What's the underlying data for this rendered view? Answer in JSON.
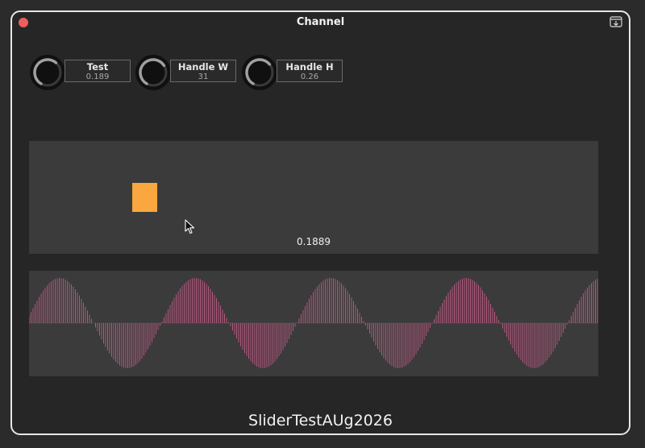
{
  "window": {
    "title": "Channel"
  },
  "knobs": [
    {
      "name": "Test",
      "value": "0.189",
      "level": 0.189
    },
    {
      "name": "Handle W",
      "value": "31",
      "level": 0.31
    },
    {
      "name": "Handle H",
      "value": "0.26",
      "level": 0.26
    }
  ],
  "slider": {
    "value": "0.1889",
    "level": 0.1889
  },
  "waveform": {
    "cycles": 4.2,
    "color": "#b5577f"
  },
  "footer": {
    "text": "SliderTestAUg2026"
  },
  "colors": {
    "accent": "#f9a73e",
    "panel": "#3b3b3b",
    "background": "#262626",
    "knob_ring": "#9a9a9a"
  }
}
